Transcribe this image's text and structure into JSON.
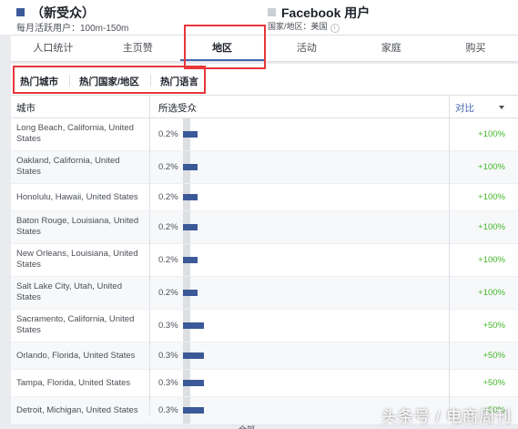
{
  "header": {
    "audience_a": {
      "title": "（新受众）",
      "subtitle": "每月活跃用户：100m-150m"
    },
    "audience_b": {
      "title": "Facebook 用户",
      "subtitle": "国家/地区：美国",
      "info_icon": "info-icon"
    }
  },
  "tabs": [
    {
      "label": "人口统计"
    },
    {
      "label": "主页赞"
    },
    {
      "label": "地区",
      "active": true
    },
    {
      "label": "活动"
    },
    {
      "label": "家庭"
    },
    {
      "label": "购买"
    }
  ],
  "subtabs": [
    {
      "label": "热门城市",
      "active": true
    },
    {
      "label": "热门国家/地区"
    },
    {
      "label": "热门语言"
    }
  ],
  "table": {
    "columns": {
      "city": "城市",
      "audience": "所选受众",
      "compare": "对比"
    },
    "rows": [
      {
        "city": "Long Beach, California, United States",
        "pct": "0.2%",
        "share": 0.2,
        "compare": "+100%"
      },
      {
        "city": "Oakland, California, United States",
        "pct": "0.2%",
        "share": 0.2,
        "compare": "+100%"
      },
      {
        "city": "Honolulu, Hawaii, United States",
        "pct": "0.2%",
        "share": 0.2,
        "compare": "+100%"
      },
      {
        "city": "Baton Rouge, Louisiana, United States",
        "pct": "0.2%",
        "share": 0.2,
        "compare": "+100%"
      },
      {
        "city": "New Orleans, Louisiana, United States",
        "pct": "0.2%",
        "share": 0.2,
        "compare": "+100%"
      },
      {
        "city": "Salt Lake City, Utah, United States",
        "pct": "0.2%",
        "share": 0.2,
        "compare": "+100%"
      },
      {
        "city": "Sacramento, California, United States",
        "pct": "0.3%",
        "share": 0.3,
        "compare": "+50%"
      },
      {
        "city": "Orlando, Florida, United States",
        "pct": "0.3%",
        "share": 0.3,
        "compare": "+50%"
      },
      {
        "city": "Tampa, Florida, United States",
        "pct": "0.3%",
        "share": 0.3,
        "compare": "+50%"
      },
      {
        "city": "Detroit, Michigan, United States",
        "pct": "0.3%",
        "share": 0.3,
        "compare": "+50%"
      }
    ]
  },
  "footer": {
    "button_label": "全部"
  },
  "watermark": "头条号 / 电商周刊",
  "colors": {
    "brand": "#3b5998",
    "positive": "#42b72a",
    "highlight": "#e8363b",
    "link": "#4267b2"
  }
}
